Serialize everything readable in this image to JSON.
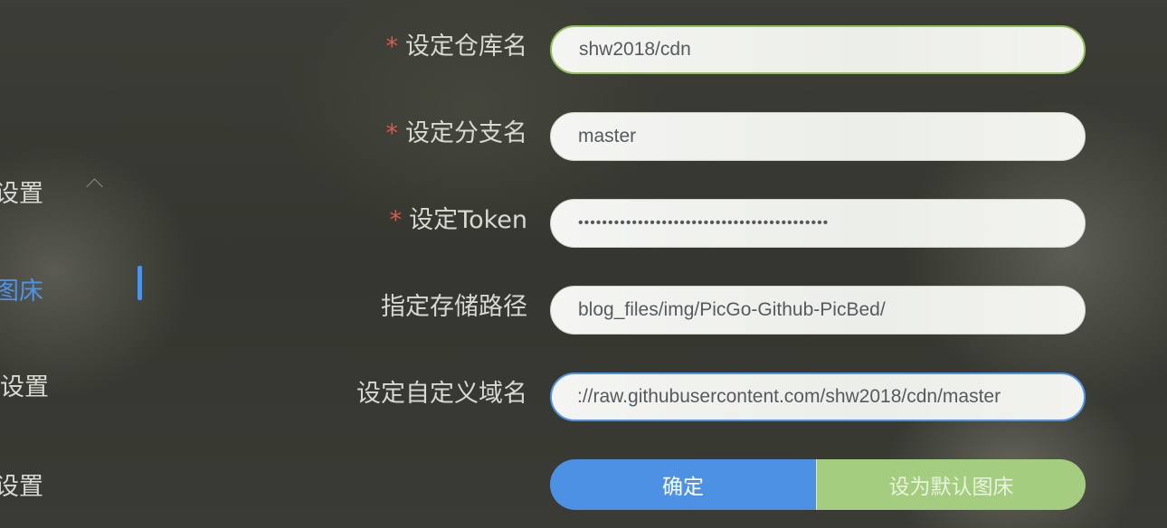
{
  "sidebar": {
    "items": [
      {
        "label": "设置"
      },
      {
        "label": "图床"
      },
      {
        "label": "设置"
      },
      {
        "label": "设置"
      }
    ]
  },
  "form": {
    "required_mark": "*",
    "repo": {
      "label": "设定仓库名",
      "value": "shw2018/cdn"
    },
    "branch": {
      "label": "设定分支名",
      "value": "master"
    },
    "token": {
      "label": "设定Token",
      "value": "••••••••••••••••••••••••••••••••••••••••••"
    },
    "path": {
      "label": "指定存储路径",
      "value": "blog_files/img/PicGo-Github-PicBed/"
    },
    "custom_url": {
      "label": "设定自定义域名",
      "value": "://raw.githubusercontent.com/shw2018/cdn/master"
    }
  },
  "buttons": {
    "confirm": "确定",
    "set_default": "设为默认图床"
  },
  "colors": {
    "accent_blue": "#4d91e5",
    "accent_green": "#a4cd7f",
    "required_red": "#e2574c"
  }
}
